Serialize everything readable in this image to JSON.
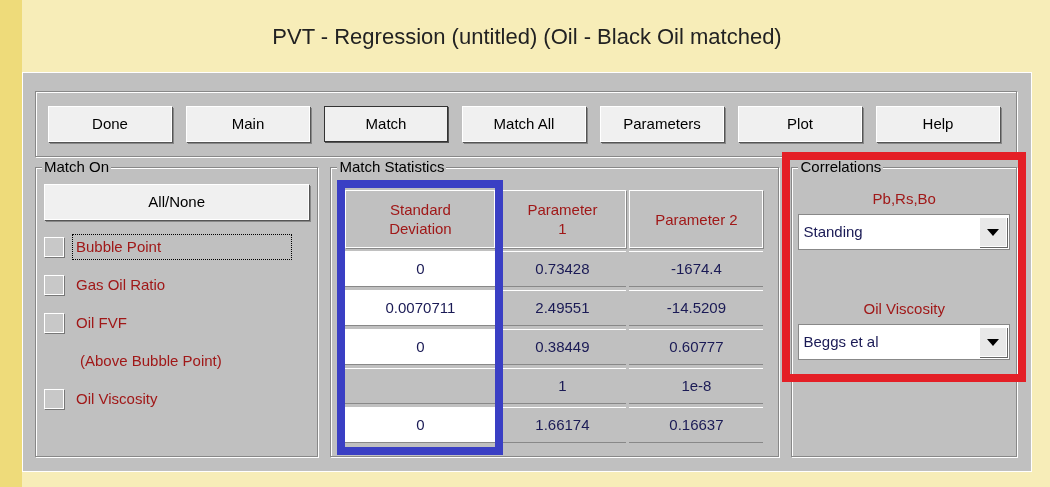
{
  "window": {
    "title": "PVT - Regression (untitled)  (Oil - Black Oil matched)"
  },
  "toolbar": {
    "buttons": [
      {
        "label": "Done",
        "selected": false
      },
      {
        "label": "Main",
        "selected": false
      },
      {
        "label": "Match",
        "selected": true
      },
      {
        "label": "Match All",
        "selected": false
      },
      {
        "label": "Parameters",
        "selected": false
      },
      {
        "label": "Plot",
        "selected": false
      },
      {
        "label": "Help",
        "selected": false
      }
    ]
  },
  "match_on": {
    "title": "Match On",
    "all_none_button": "All/None",
    "items": [
      {
        "kind": "checkbox",
        "label": "Bubble Point",
        "checked": false,
        "focused": true
      },
      {
        "kind": "checkbox",
        "label": "Gas Oil Ratio",
        "checked": false,
        "focused": false
      },
      {
        "kind": "checkbox",
        "label": "Oil FVF",
        "checked": false,
        "focused": false
      },
      {
        "kind": "note",
        "label": "(Above Bubble Point)"
      },
      {
        "kind": "checkbox",
        "label": "Oil Viscosity",
        "checked": false,
        "focused": false
      }
    ]
  },
  "match_statistics": {
    "title": "Match Statistics",
    "columns": [
      {
        "label": "Standard Deviation",
        "color": "#3a3fc4"
      },
      {
        "label": "Parameter 1"
      },
      {
        "label": "Parameter 2"
      }
    ],
    "rows": [
      {
        "std_dev": "0",
        "parameter_1": "0.73428",
        "parameter_2": "-1674.4"
      },
      {
        "std_dev": "0.0070711",
        "parameter_1": "2.49551",
        "parameter_2": "-14.5209"
      },
      {
        "std_dev": "0",
        "parameter_1": "0.38449",
        "parameter_2": "0.60777"
      },
      {
        "parameter_1": "1",
        "parameter_2": "1e-8"
      },
      {
        "std_dev": "0",
        "parameter_1": "1.66174",
        "parameter_2": "0.16637"
      }
    ]
  },
  "correlations": {
    "title": "Correlations",
    "color": "#e41f26",
    "groups": [
      {
        "label": "Pb,Rs,Bo",
        "value": "Standing"
      },
      {
        "label": "Oil Viscosity",
        "value": "Beggs et al"
      }
    ]
  }
}
